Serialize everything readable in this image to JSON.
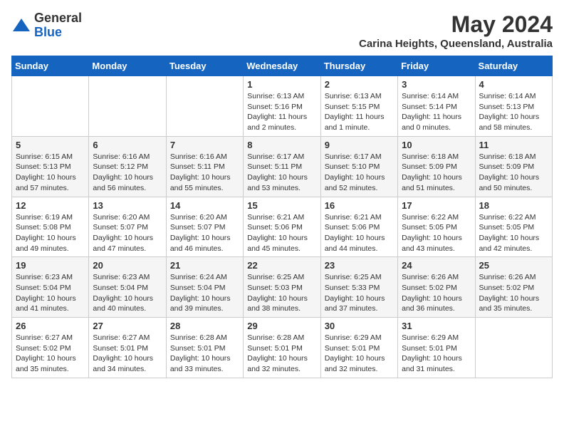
{
  "header": {
    "logo_general": "General",
    "logo_blue": "Blue",
    "month_year": "May 2024",
    "location": "Carina Heights, Queensland, Australia"
  },
  "days_of_week": [
    "Sunday",
    "Monday",
    "Tuesday",
    "Wednesday",
    "Thursday",
    "Friday",
    "Saturday"
  ],
  "weeks": [
    [
      {
        "day": "",
        "info": ""
      },
      {
        "day": "",
        "info": ""
      },
      {
        "day": "",
        "info": ""
      },
      {
        "day": "1",
        "info": "Sunrise: 6:13 AM\nSunset: 5:16 PM\nDaylight: 11 hours\nand 2 minutes."
      },
      {
        "day": "2",
        "info": "Sunrise: 6:13 AM\nSunset: 5:15 PM\nDaylight: 11 hours\nand 1 minute."
      },
      {
        "day": "3",
        "info": "Sunrise: 6:14 AM\nSunset: 5:14 PM\nDaylight: 11 hours\nand 0 minutes."
      },
      {
        "day": "4",
        "info": "Sunrise: 6:14 AM\nSunset: 5:13 PM\nDaylight: 10 hours\nand 58 minutes."
      }
    ],
    [
      {
        "day": "5",
        "info": "Sunrise: 6:15 AM\nSunset: 5:13 PM\nDaylight: 10 hours\nand 57 minutes."
      },
      {
        "day": "6",
        "info": "Sunrise: 6:16 AM\nSunset: 5:12 PM\nDaylight: 10 hours\nand 56 minutes."
      },
      {
        "day": "7",
        "info": "Sunrise: 6:16 AM\nSunset: 5:11 PM\nDaylight: 10 hours\nand 55 minutes."
      },
      {
        "day": "8",
        "info": "Sunrise: 6:17 AM\nSunset: 5:11 PM\nDaylight: 10 hours\nand 53 minutes."
      },
      {
        "day": "9",
        "info": "Sunrise: 6:17 AM\nSunset: 5:10 PM\nDaylight: 10 hours\nand 52 minutes."
      },
      {
        "day": "10",
        "info": "Sunrise: 6:18 AM\nSunset: 5:09 PM\nDaylight: 10 hours\nand 51 minutes."
      },
      {
        "day": "11",
        "info": "Sunrise: 6:18 AM\nSunset: 5:09 PM\nDaylight: 10 hours\nand 50 minutes."
      }
    ],
    [
      {
        "day": "12",
        "info": "Sunrise: 6:19 AM\nSunset: 5:08 PM\nDaylight: 10 hours\nand 49 minutes."
      },
      {
        "day": "13",
        "info": "Sunrise: 6:20 AM\nSunset: 5:07 PM\nDaylight: 10 hours\nand 47 minutes."
      },
      {
        "day": "14",
        "info": "Sunrise: 6:20 AM\nSunset: 5:07 PM\nDaylight: 10 hours\nand 46 minutes."
      },
      {
        "day": "15",
        "info": "Sunrise: 6:21 AM\nSunset: 5:06 PM\nDaylight: 10 hours\nand 45 minutes."
      },
      {
        "day": "16",
        "info": "Sunrise: 6:21 AM\nSunset: 5:06 PM\nDaylight: 10 hours\nand 44 minutes."
      },
      {
        "day": "17",
        "info": "Sunrise: 6:22 AM\nSunset: 5:05 PM\nDaylight: 10 hours\nand 43 minutes."
      },
      {
        "day": "18",
        "info": "Sunrise: 6:22 AM\nSunset: 5:05 PM\nDaylight: 10 hours\nand 42 minutes."
      }
    ],
    [
      {
        "day": "19",
        "info": "Sunrise: 6:23 AM\nSunset: 5:04 PM\nDaylight: 10 hours\nand 41 minutes."
      },
      {
        "day": "20",
        "info": "Sunrise: 6:23 AM\nSunset: 5:04 PM\nDaylight: 10 hours\nand 40 minutes."
      },
      {
        "day": "21",
        "info": "Sunrise: 6:24 AM\nSunset: 5:04 PM\nDaylight: 10 hours\nand 39 minutes."
      },
      {
        "day": "22",
        "info": "Sunrise: 6:25 AM\nSunset: 5:03 PM\nDaylight: 10 hours\nand 38 minutes."
      },
      {
        "day": "23",
        "info": "Sunrise: 6:25 AM\nSunset: 5:33 PM\nDaylight: 10 hours\nand 37 minutes."
      },
      {
        "day": "24",
        "info": "Sunrise: 6:26 AM\nSunset: 5:02 PM\nDaylight: 10 hours\nand 36 minutes."
      },
      {
        "day": "25",
        "info": "Sunrise: 6:26 AM\nSunset: 5:02 PM\nDaylight: 10 hours\nand 35 minutes."
      }
    ],
    [
      {
        "day": "26",
        "info": "Sunrise: 6:27 AM\nSunset: 5:02 PM\nDaylight: 10 hours\nand 35 minutes."
      },
      {
        "day": "27",
        "info": "Sunrise: 6:27 AM\nSunset: 5:01 PM\nDaylight: 10 hours\nand 34 minutes."
      },
      {
        "day": "28",
        "info": "Sunrise: 6:28 AM\nSunset: 5:01 PM\nDaylight: 10 hours\nand 33 minutes."
      },
      {
        "day": "29",
        "info": "Sunrise: 6:28 AM\nSunset: 5:01 PM\nDaylight: 10 hours\nand 32 minutes."
      },
      {
        "day": "30",
        "info": "Sunrise: 6:29 AM\nSunset: 5:01 PM\nDaylight: 10 hours\nand 32 minutes."
      },
      {
        "day": "31",
        "info": "Sunrise: 6:29 AM\nSunset: 5:01 PM\nDaylight: 10 hours\nand 31 minutes."
      },
      {
        "day": "",
        "info": ""
      }
    ]
  ]
}
